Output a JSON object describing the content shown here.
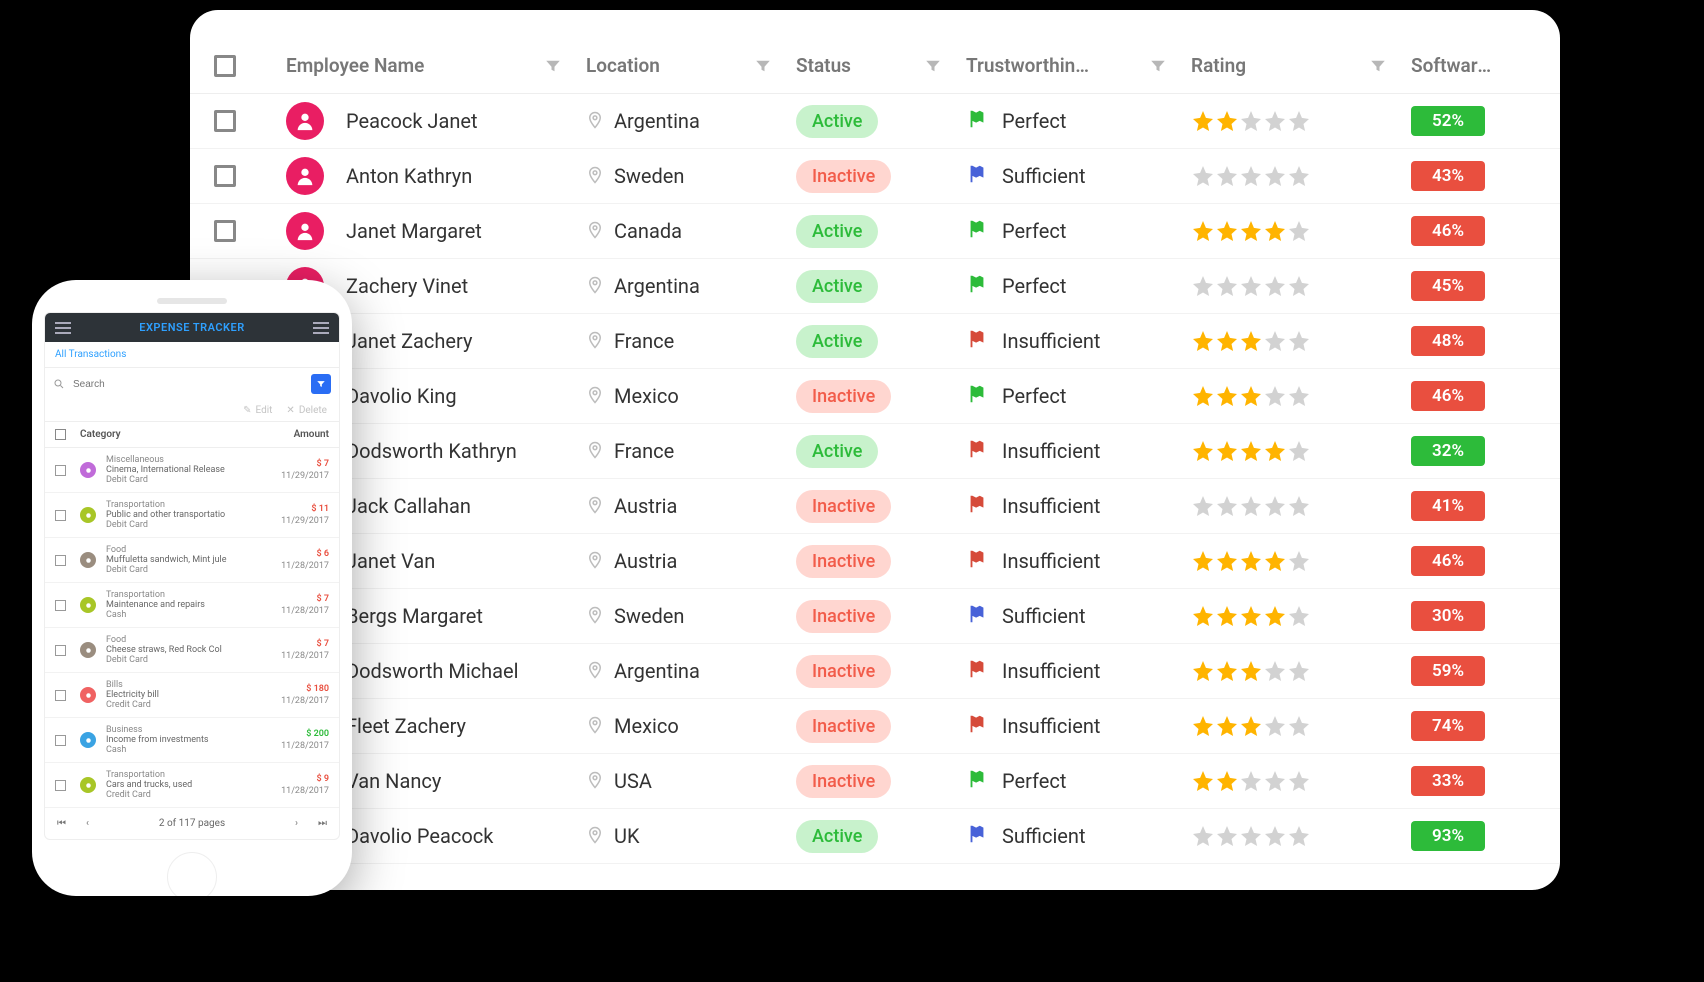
{
  "grid": {
    "columns": {
      "name": "Employee Name",
      "location": "Location",
      "status": "Status",
      "trust": "Trustworthin…",
      "rating": "Rating",
      "software": "Software F"
    },
    "rows": [
      {
        "name": "Peacock Janet",
        "location": "Argentina",
        "status": "Active",
        "trust": "Perfect",
        "flag": "green",
        "rating": 2,
        "pct": "52%",
        "pctColor": "green"
      },
      {
        "name": "Anton Kathryn",
        "location": "Sweden",
        "status": "Inactive",
        "trust": "Sufficient",
        "flag": "blue",
        "rating": 0,
        "pct": "43%",
        "pctColor": "red"
      },
      {
        "name": "Janet Margaret",
        "location": "Canada",
        "status": "Active",
        "trust": "Perfect",
        "flag": "green",
        "rating": 4,
        "pct": "46%",
        "pctColor": "red"
      },
      {
        "name": "Zachery Vinet",
        "location": "Argentina",
        "status": "Active",
        "trust": "Perfect",
        "flag": "green",
        "rating": 0,
        "pct": "45%",
        "pctColor": "red"
      },
      {
        "name": "Janet Zachery",
        "location": "France",
        "status": "Active",
        "trust": "Insufficient",
        "flag": "red",
        "rating": 3,
        "pct": "48%",
        "pctColor": "red"
      },
      {
        "name": "Davolio King",
        "location": "Mexico",
        "status": "Inactive",
        "trust": "Perfect",
        "flag": "green",
        "rating": 3,
        "pct": "46%",
        "pctColor": "red"
      },
      {
        "name": "Dodsworth Kathryn",
        "location": "France",
        "status": "Active",
        "trust": "Insufficient",
        "flag": "red",
        "rating": 4,
        "pct": "32%",
        "pctColor": "green"
      },
      {
        "name": "Jack Callahan",
        "location": "Austria",
        "status": "Inactive",
        "trust": "Insufficient",
        "flag": "red",
        "rating": 0,
        "pct": "41%",
        "pctColor": "red"
      },
      {
        "name": "Janet Van",
        "location": "Austria",
        "status": "Inactive",
        "trust": "Insufficient",
        "flag": "red",
        "rating": 4,
        "pct": "46%",
        "pctColor": "red"
      },
      {
        "name": "Bergs Margaret",
        "location": "Sweden",
        "status": "Inactive",
        "trust": "Sufficient",
        "flag": "blue",
        "rating": 4,
        "pct": "30%",
        "pctColor": "red"
      },
      {
        "name": "Dodsworth Michael",
        "location": "Argentina",
        "status": "Inactive",
        "trust": "Insufficient",
        "flag": "red",
        "rating": 3,
        "pct": "59%",
        "pctColor": "red"
      },
      {
        "name": "Fleet Zachery",
        "location": "Mexico",
        "status": "Inactive",
        "trust": "Insufficient",
        "flag": "red",
        "rating": 3,
        "pct": "74%",
        "pctColor": "red"
      },
      {
        "name": "Van Nancy",
        "location": "USA",
        "status": "Inactive",
        "trust": "Perfect",
        "flag": "green",
        "rating": 2,
        "pct": "33%",
        "pctColor": "red"
      },
      {
        "name": "Davolio Peacock",
        "location": "UK",
        "status": "Active",
        "trust": "Sufficient",
        "flag": "blue",
        "rating": 0,
        "pct": "93%",
        "pctColor": "green"
      }
    ]
  },
  "phone": {
    "appTitle": "EXPENSE TRACKER",
    "subHeader": "All Transactions",
    "searchPlaceholder": "Search",
    "editLabel": "Edit",
    "deleteLabel": "Delete",
    "columns": {
      "category": "Category",
      "amount": "Amount"
    },
    "pager": "2 of 117 pages",
    "rows": [
      {
        "iconColor": "#c06bd9",
        "cat": "Miscellaneous",
        "desc": "Cinema, International Release",
        "pay": "Debit Card",
        "amt": "$ 7",
        "amtClass": "red",
        "date": "11/29/2017"
      },
      {
        "iconColor": "#a8c627",
        "cat": "Transportation",
        "desc": "Public and other transportatio",
        "pay": "Debit Card",
        "amt": "$ 11",
        "amtClass": "red",
        "date": "11/29/2017"
      },
      {
        "iconColor": "#9a8d7f",
        "cat": "Food",
        "desc": "Muffuletta sandwich, Mint jule",
        "pay": "Debit Card",
        "amt": "$ 6",
        "amtClass": "red",
        "date": "11/28/2017"
      },
      {
        "iconColor": "#a8c627",
        "cat": "Transportation",
        "desc": "Maintenance and repairs",
        "pay": "Cash",
        "amt": "$ 7",
        "amtClass": "red",
        "date": "11/28/2017"
      },
      {
        "iconColor": "#9a8d7f",
        "cat": "Food",
        "desc": "Cheese straws, Red Rock Col",
        "pay": "Debit Card",
        "amt": "$ 7",
        "amtClass": "red",
        "date": "11/28/2017"
      },
      {
        "iconColor": "#f06262",
        "cat": "Bills",
        "desc": "Electricity bill",
        "pay": "Credit Card",
        "amt": "$ 180",
        "amtClass": "red",
        "date": "11/28/2017"
      },
      {
        "iconColor": "#3aa3e3",
        "cat": "Business",
        "desc": "Income from investments",
        "pay": "Cash",
        "amt": "$ 200",
        "amtClass": "green",
        "date": "11/28/2017"
      },
      {
        "iconColor": "#a8c627",
        "cat": "Transportation",
        "desc": "Cars and trucks, used",
        "pay": "Credit Card",
        "amt": "$ 9",
        "amtClass": "red",
        "date": "11/28/2017"
      }
    ]
  }
}
